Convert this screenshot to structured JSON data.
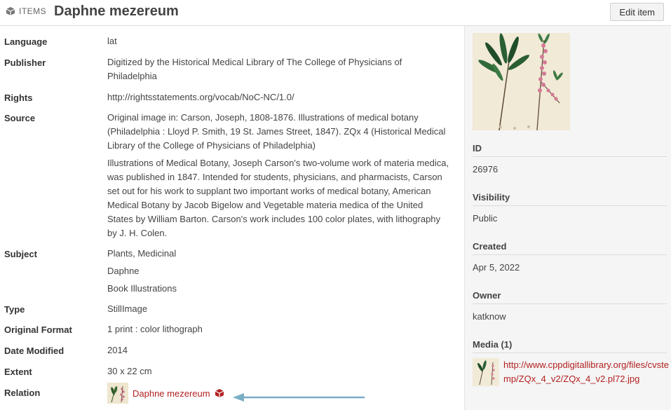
{
  "header": {
    "type_label": "ITEMS",
    "title": "Daphne mezereum",
    "edit_label": "Edit item"
  },
  "metadata": {
    "language": {
      "label": "Language",
      "value": "lat"
    },
    "publisher": {
      "label": "Publisher",
      "value": "Digitized by the Historical Medical Library of The College of Physicians of Philadelphia"
    },
    "rights": {
      "label": "Rights",
      "value": "http://rightsstatements.org/vocab/NoC-NC/1.0/"
    },
    "source": {
      "label": "Source",
      "values": [
        "Original image in: Carson, Joseph, 1808-1876. Illustrations of medical botany (Philadelphia : Lloyd P. Smith, 19 St. James Street, 1847). ZQx 4 (Historical Medical Library of the College of Physicians of Philadelphia)",
        "Illustrations of Medical Botany, Joseph Carson's two-volume work of materia medica, was published in 1847. Intended for students, physicians, and pharmacists, Carson set out for his work to supplant two important works of medical botany, American Medical Botany by Jacob Bigelow and Vegetable materia medica of the United States by William Barton. Carson's work includes 100 color plates, with lithography by J. H. Colen."
      ]
    },
    "subject": {
      "label": "Subject",
      "values": [
        "Plants, Medicinal",
        "Daphne",
        "Book Illustrations"
      ]
    },
    "type": {
      "label": "Type",
      "value": "StillImage"
    },
    "original_format": {
      "label": "Original Format",
      "value": "1 print : color lithograph"
    },
    "date_modified": {
      "label": "Date Modified",
      "value": "2014"
    },
    "extent": {
      "label": "Extent",
      "value": "30 x 22 cm"
    },
    "relation": {
      "label": "Relation",
      "value": "Daphne mezereum"
    }
  },
  "sidebar": {
    "id": {
      "label": "ID",
      "value": "26976"
    },
    "visibility": {
      "label": "Visibility",
      "value": "Public"
    },
    "created": {
      "label": "Created",
      "value": "Apr 5, 2022"
    },
    "owner": {
      "label": "Owner",
      "value": "katknow"
    },
    "media": {
      "label": "Media (1)",
      "link": "http://www.cppdigitallibrary.org/files/cvstemp/ZQx_4_v2/ZQx_4_v2.pl72.jpg"
    }
  },
  "colors": {
    "link": "#b32121",
    "arrow": "#7aaec4",
    "sidebar_bg": "#f5f5f5"
  },
  "icons": {
    "type_badge": "cube-icon",
    "relation_type": "item-cube-icon",
    "annotation": "arrow-left-icon"
  }
}
